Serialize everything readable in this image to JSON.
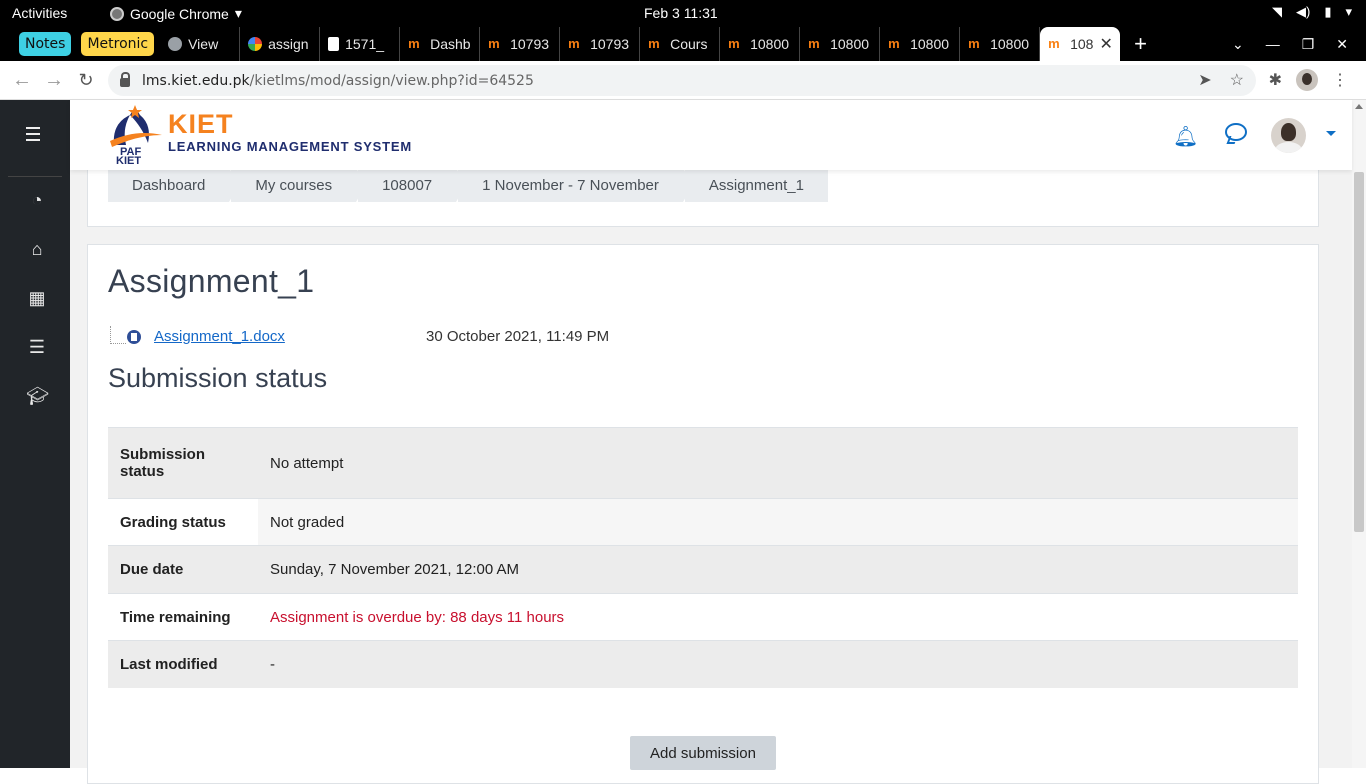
{
  "system": {
    "activities": "Activities",
    "app_name": "Google Chrome",
    "clock": "Feb 3  11:31"
  },
  "browser": {
    "bookmarks": [
      "Notes",
      "Metronic"
    ],
    "tabs": [
      {
        "title": "View",
        "icon": "globe-icon"
      },
      {
        "title": "assign",
        "icon": "google-icon"
      },
      {
        "title": "1571_",
        "icon": "doc-icon"
      },
      {
        "title": "Dashb",
        "icon": "moodle-icon"
      },
      {
        "title": "10793",
        "icon": "moodle-icon"
      },
      {
        "title": "10793",
        "icon": "moodle-icon"
      },
      {
        "title": "Cours",
        "icon": "moodle-icon"
      },
      {
        "title": "10800",
        "icon": "moodle-icon"
      },
      {
        "title": "10800",
        "icon": "moodle-icon"
      },
      {
        "title": "10800",
        "icon": "moodle-icon"
      },
      {
        "title": "10800",
        "icon": "moodle-icon"
      },
      {
        "title": "108",
        "icon": "moodle-icon"
      }
    ],
    "url_host": "lms.kiet.edu.pk",
    "url_path": "/kietlms/mod/assign/view.php?id=64525"
  },
  "header": {
    "logo_text_top": "PAF",
    "logo_text_bottom": "KIET",
    "brand": "KIET",
    "tagline": "LEARNING MANAGEMENT SYSTEM"
  },
  "breadcrumb": [
    "Dashboard",
    "My courses",
    "108007",
    "1 November - 7 November",
    "Assignment_1"
  ],
  "page": {
    "title": "Assignment_1",
    "file_name": "Assignment_1.docx",
    "file_date": "30 October 2021, 11:49 PM",
    "section_title": "Submission status"
  },
  "status_rows": [
    {
      "label": "Submission status",
      "value": "No attempt"
    },
    {
      "label": "Grading status",
      "value": "Not graded"
    },
    {
      "label": "Due date",
      "value": "Sunday, 7 November 2021, 12:00 AM"
    },
    {
      "label": "Time remaining",
      "value": "Assignment is overdue by: 88 days 11 hours"
    },
    {
      "label": "Last modified",
      "value": "-"
    }
  ],
  "actions": {
    "add_submission": "Add submission"
  },
  "colors": {
    "brand_orange": "#f5821f",
    "brand_navy": "#1f2d6e",
    "link_blue": "#1468c8",
    "overdue_red": "#c8102e"
  }
}
